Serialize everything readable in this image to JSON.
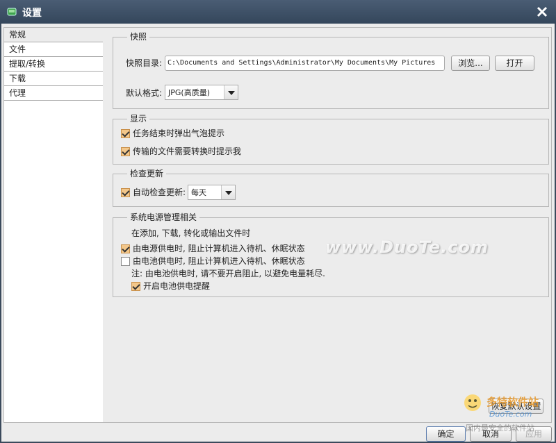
{
  "window": {
    "title": "设置"
  },
  "sidebar": {
    "items": [
      {
        "label": "常规"
      },
      {
        "label": "文件"
      },
      {
        "label": "提取/转换"
      },
      {
        "label": "下载"
      },
      {
        "label": "代理"
      }
    ]
  },
  "snapshot": {
    "group_title": "快照",
    "dir_label": "快照目录:",
    "dir_value": "C:\\Documents and Settings\\Administrator\\My Documents\\My Pictures",
    "browse_label": "浏览...",
    "open_label": "打开",
    "format_label": "默认格式:",
    "format_value": "JPG(高质量)"
  },
  "display": {
    "group_title": "显示",
    "option1": {
      "label": "任务结束时弹出气泡提示",
      "checked": true
    },
    "option2": {
      "label": "传输的文件需要转换时提示我",
      "checked": true
    }
  },
  "update": {
    "group_title": "检查更新",
    "auto_label": "自动检查更新:",
    "auto_checked": true,
    "frequency_value": "每天"
  },
  "power": {
    "group_title": "系统电源管理相关",
    "intro": "在添加, 下载, 转化或输出文件时",
    "ac_option": {
      "label": "由电源供电时, 阻止计算机进入待机、休眠状态",
      "checked": true
    },
    "battery_option": {
      "label": "由电池供电时, 阻止计算机进入待机、休眠状态",
      "checked": false
    },
    "note": "注: 由电池供电时, 请不要开启阻止, 以避免电量耗尽.",
    "battery_reminder": {
      "label": "开启电池供电提醒",
      "checked": true
    }
  },
  "footer": {
    "restore_label": "恢复默认设置",
    "ok_label": "确定",
    "cancel_label": "取消",
    "apply_label": "应用"
  },
  "watermark": {
    "text": "www.DuoTe.com",
    "logo_text": "多特软件站",
    "logo_sub": "DuoTe.com",
    "logo_slogan": "国内最安全的软件站"
  },
  "colors": {
    "titlebar": "#3b4a5c",
    "checkbox_checked": "#f3c78a",
    "panel_bg": "#ececec"
  }
}
